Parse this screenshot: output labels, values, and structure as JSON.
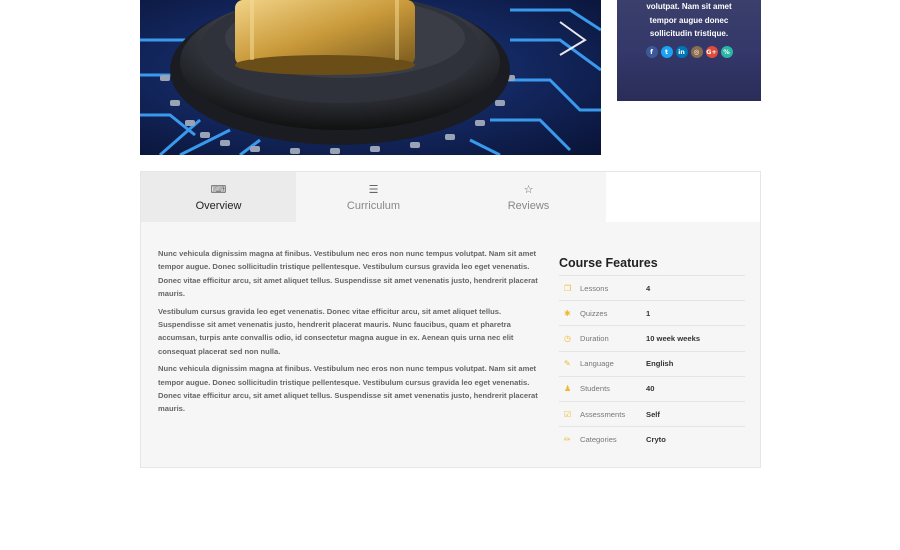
{
  "instructor": {
    "text_lines": [
      "volutpat. Nam sit amet",
      "tempor augue donec",
      "sollicitudin tristique."
    ],
    "social": [
      {
        "icon": "facebook-icon",
        "glyph": "f",
        "color": "#3b5998"
      },
      {
        "icon": "twitter-icon",
        "glyph": "t",
        "color": "#1da1f2"
      },
      {
        "icon": "linkedin-icon",
        "glyph": "in",
        "color": "#0077b5"
      },
      {
        "icon": "instagram-icon",
        "glyph": "◎",
        "color": "#8a6d4e"
      },
      {
        "icon": "google-plus-icon",
        "glyph": "G+",
        "color": "#dd4b39"
      },
      {
        "icon": "link-icon",
        "glyph": "%",
        "color": "#2bb5a5"
      }
    ]
  },
  "tabs": [
    {
      "label": "Overview",
      "icon": "keyboard-icon",
      "glyph": "⌨",
      "active": true
    },
    {
      "label": "Curriculum",
      "icon": "list-icon",
      "glyph": "☰",
      "active": false
    },
    {
      "label": "Reviews",
      "icon": "star-icon",
      "glyph": "☆",
      "active": false
    }
  ],
  "overview": {
    "paragraphs": [
      "Nunc vehicula dignissim magna at finibus. Vestibulum nec eros non nunc tempus volutpat. Nam sit amet tempor augue. Donec sollicitudin tristique pellentesque. Vestibulum cursus gravida leo eget venenatis. Donec vitae efficitur arcu, sit amet aliquet tellus. Suspendisse sit amet venenatis justo, hendrerit placerat mauris.",
      "Vestibulum cursus gravida leo eget venenatis. Donec vitae efficitur arcu, sit amet aliquet tellus. Suspendisse sit amet venenatis justo, hendrerit placerat mauris. Nunc faucibus, quam et pharetra accumsan, turpis ante convallis odio, id consectetur magna augue in ex. Aenean quis urna nec elit consequat placerat sed non nulla.",
      "Nunc vehicula dignissim magna at finibus. Vestibulum nec eros non nunc tempus volutpat. Nam sit amet tempor augue. Donec sollicitudin tristique pellentesque. Vestibulum cursus gravida leo eget venenatis. Donec vitae efficitur arcu, sit amet aliquet tellus. Suspendisse sit amet venenatis justo, hendrerit placerat mauris."
    ]
  },
  "features": {
    "title": "Course Features",
    "rows": [
      {
        "icon": "copy-icon",
        "glyph": "❐",
        "name": "Lessons",
        "value": "4"
      },
      {
        "icon": "puzzle-icon",
        "glyph": "✱",
        "name": "Quizzes",
        "value": "1"
      },
      {
        "icon": "clock-icon",
        "glyph": "◷",
        "name": "Duration",
        "value": "10 week weeks"
      },
      {
        "icon": "language-icon",
        "glyph": "✎",
        "name": "Language",
        "value": "English"
      },
      {
        "icon": "users-icon",
        "glyph": "♟",
        "name": "Students",
        "value": "40"
      },
      {
        "icon": "check-square-icon",
        "glyph": "☑",
        "name": "Assessments",
        "value": "Self"
      },
      {
        "icon": "pencil-icon",
        "glyph": "✏",
        "name": "Categories",
        "value": "Cryto"
      }
    ]
  }
}
